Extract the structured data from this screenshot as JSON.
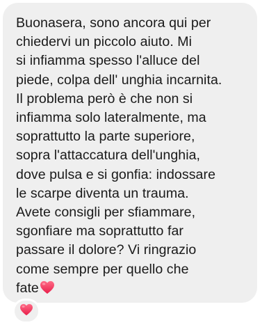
{
  "message": {
    "lines": [
      "Buonasera, sono ancora qui per",
      "chiedervi un piccolo aiuto. Mi",
      "si infiamma spesso l'alluce del",
      "piede, colpa dell' unghia incarnita.",
      "Il problema però è che non si",
      "infiamma solo lateralmente, ma",
      "soprattutto la parte superiore,",
      "sopra l'attaccatura dell'unghia,",
      "dove pulsa e si gonfia: indossare",
      "le scarpe diventa  un trauma.",
      "Avete consigli per sfiammare,",
      "sgonfiare ma soprattutto far",
      "passare il dolore? Vi ringrazio",
      "come sempre per quello che",
      "fate"
    ],
    "emoji": "heart-emoji"
  },
  "reaction": {
    "emoji": "heart-emoji"
  },
  "colors": {
    "bubble": "#efefef",
    "text": "#1a1a1a",
    "heart": "#f2385a",
    "background": "#ffffff"
  }
}
